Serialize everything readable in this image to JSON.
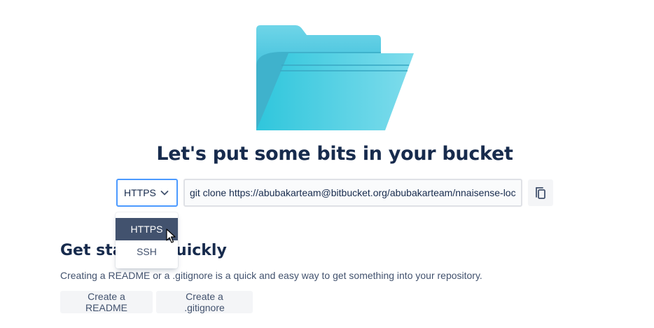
{
  "illustration": {
    "icon": "folder-icon",
    "colors": [
      "#6dd3e6",
      "#38c6de",
      "#2fa8c4"
    ]
  },
  "heading": "Let's put some bits in your bucket",
  "clone": {
    "protocol_selected": "HTTPS",
    "protocol_options": [
      "HTTPS",
      "SSH"
    ],
    "command": "git clone https://abubakarteam@bitbucket.org/abubakarteam/nnaisense-loc",
    "copy_icon": "copy-icon"
  },
  "quick_start": {
    "title": "Get started quickly",
    "description": "Creating a README or a .gitignore is a quick and easy way to get something into your repository.",
    "buttons": [
      "Create a README",
      "Create a .gitignore"
    ]
  },
  "colors": {
    "text": "#172b4d",
    "subtle_text": "#42526e",
    "focus_border": "#4c9aff",
    "selected_menu_bg": "#42526e",
    "button_bg": "#f4f5f7"
  }
}
